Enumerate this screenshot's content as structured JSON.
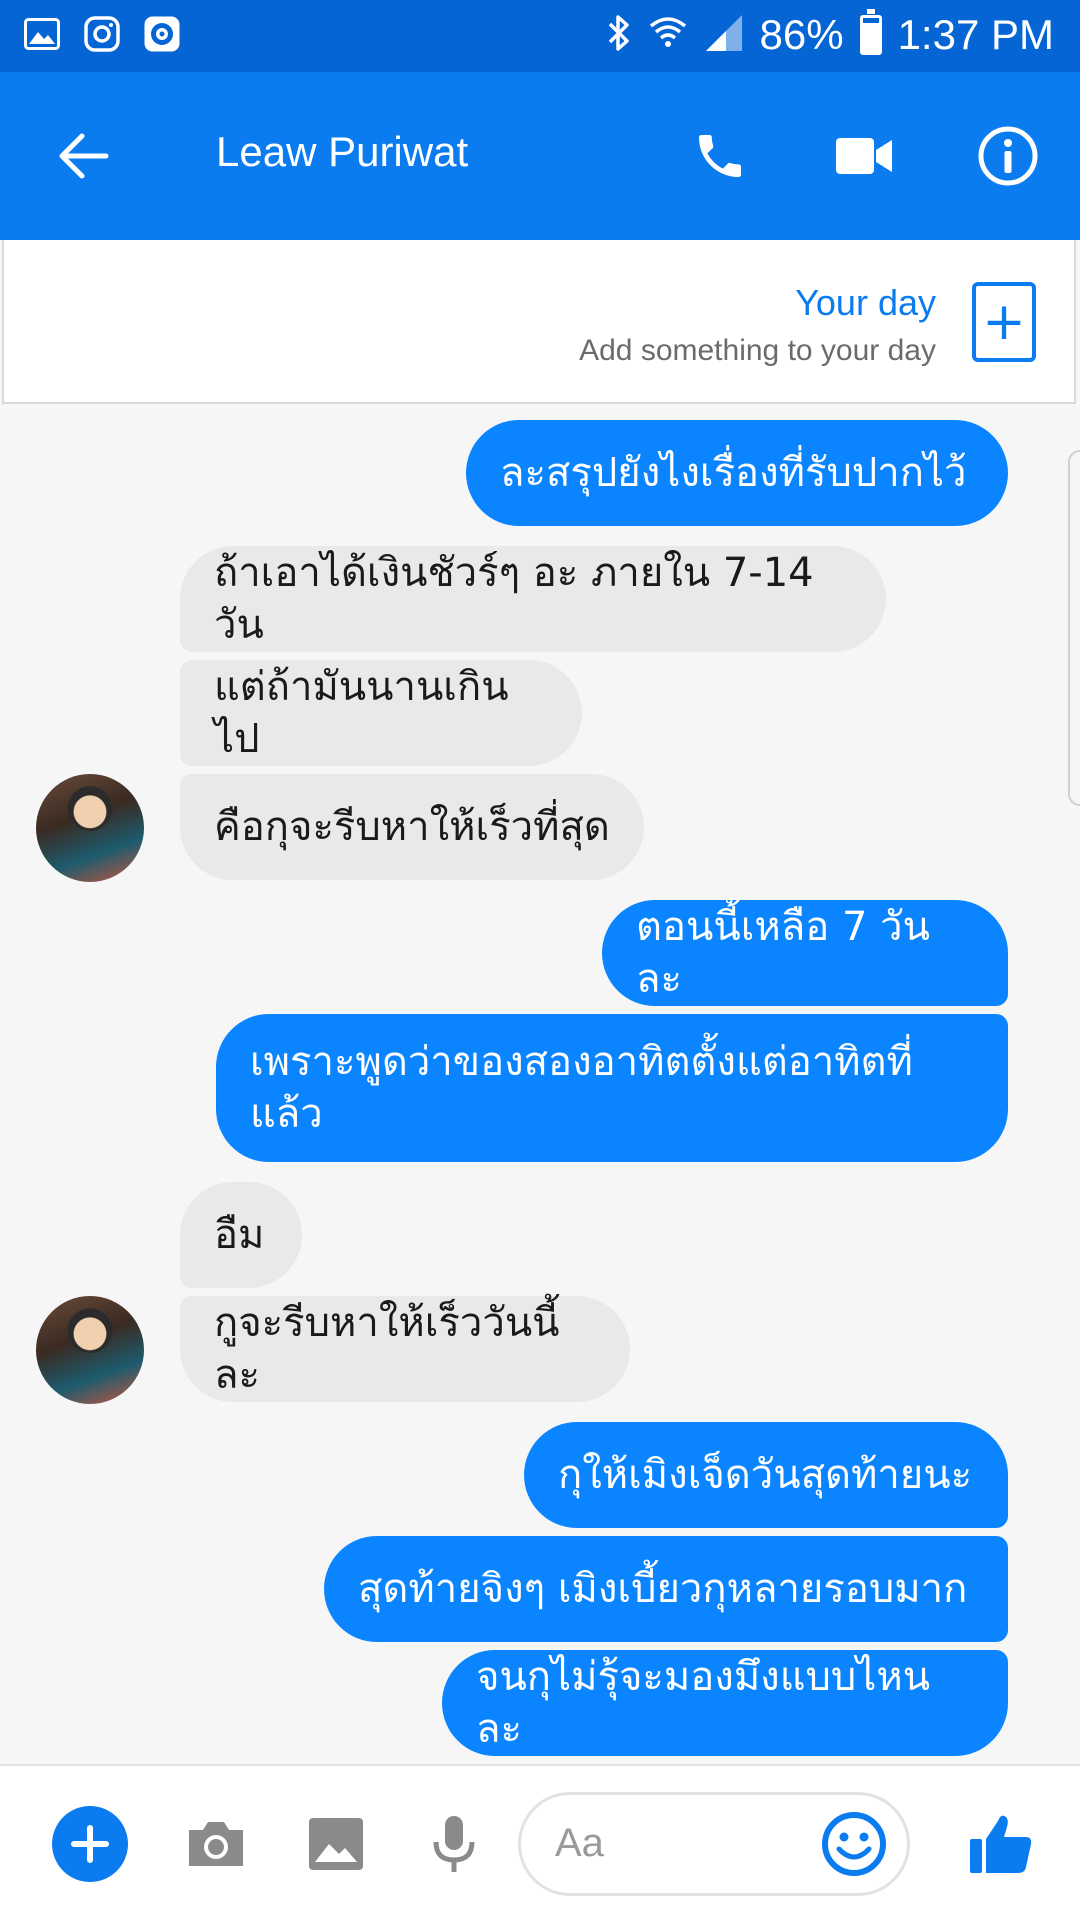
{
  "status_bar": {
    "battery": "86%",
    "time": "1:37 PM",
    "battery_level": 0.86,
    "icons_left": [
      "gallery-icon",
      "instagram-icon",
      "music-icon"
    ],
    "icons_right": [
      "bluetooth-icon",
      "wifi-icon",
      "signal-icon",
      "battery-icon"
    ]
  },
  "header": {
    "title": "Leaw Puriwat",
    "actions": [
      "back-arrow-icon",
      "phone-icon",
      "video-icon",
      "info-icon"
    ],
    "color": "#0a7cf0"
  },
  "your_day": {
    "title": "Your day",
    "subtitle": "Add something to your day",
    "add_label": "+"
  },
  "messages": [
    {
      "dir": "out",
      "text": "ละสรุปยังไงเรื่องที่รับปากไว้"
    },
    {
      "dir": "in",
      "text": "ถ้าเอาได้เงินชัวร์ๆ อะ ภายใน 7-14 วัน"
    },
    {
      "dir": "in",
      "text": "แต่ถ้ามันนานเกินไป"
    },
    {
      "dir": "in",
      "text": "คือกุจะรีบหาให้เร็วที่สุด",
      "avatar": true
    },
    {
      "dir": "out",
      "text": "ตอนนี้เหลือ 7 วันละ"
    },
    {
      "dir": "out",
      "text": "เพราะพูดว่าของสองอาทิตตั้งแต่อาทิตที่แล้ว"
    },
    {
      "dir": "in",
      "text": "อืม"
    },
    {
      "dir": "in",
      "text": "กูจะรีบหาให้เร็ววันนี้ละ",
      "avatar": true
    },
    {
      "dir": "out",
      "text": "กุให้เมิงเจ็ดวันสุดท้ายนะ"
    },
    {
      "dir": "out",
      "text": "สุดท้ายจิงๆ เมิงเบี้ยวกุหลายรอบมาก"
    },
    {
      "dir": "out",
      "text": "จนกุไม่รุ้จะมองมึงแบบไหนละ"
    }
  ],
  "composer": {
    "placeholder": "Aa",
    "icons": [
      "plus-icon",
      "camera-icon",
      "image-icon",
      "microphone-icon",
      "emoji-icon",
      "thumbs-up-icon"
    ]
  },
  "colors": {
    "outgoing_bubble": "#0a84ff",
    "incoming_bubble": "#e9e9e9",
    "status_bar": "#0565d4"
  }
}
